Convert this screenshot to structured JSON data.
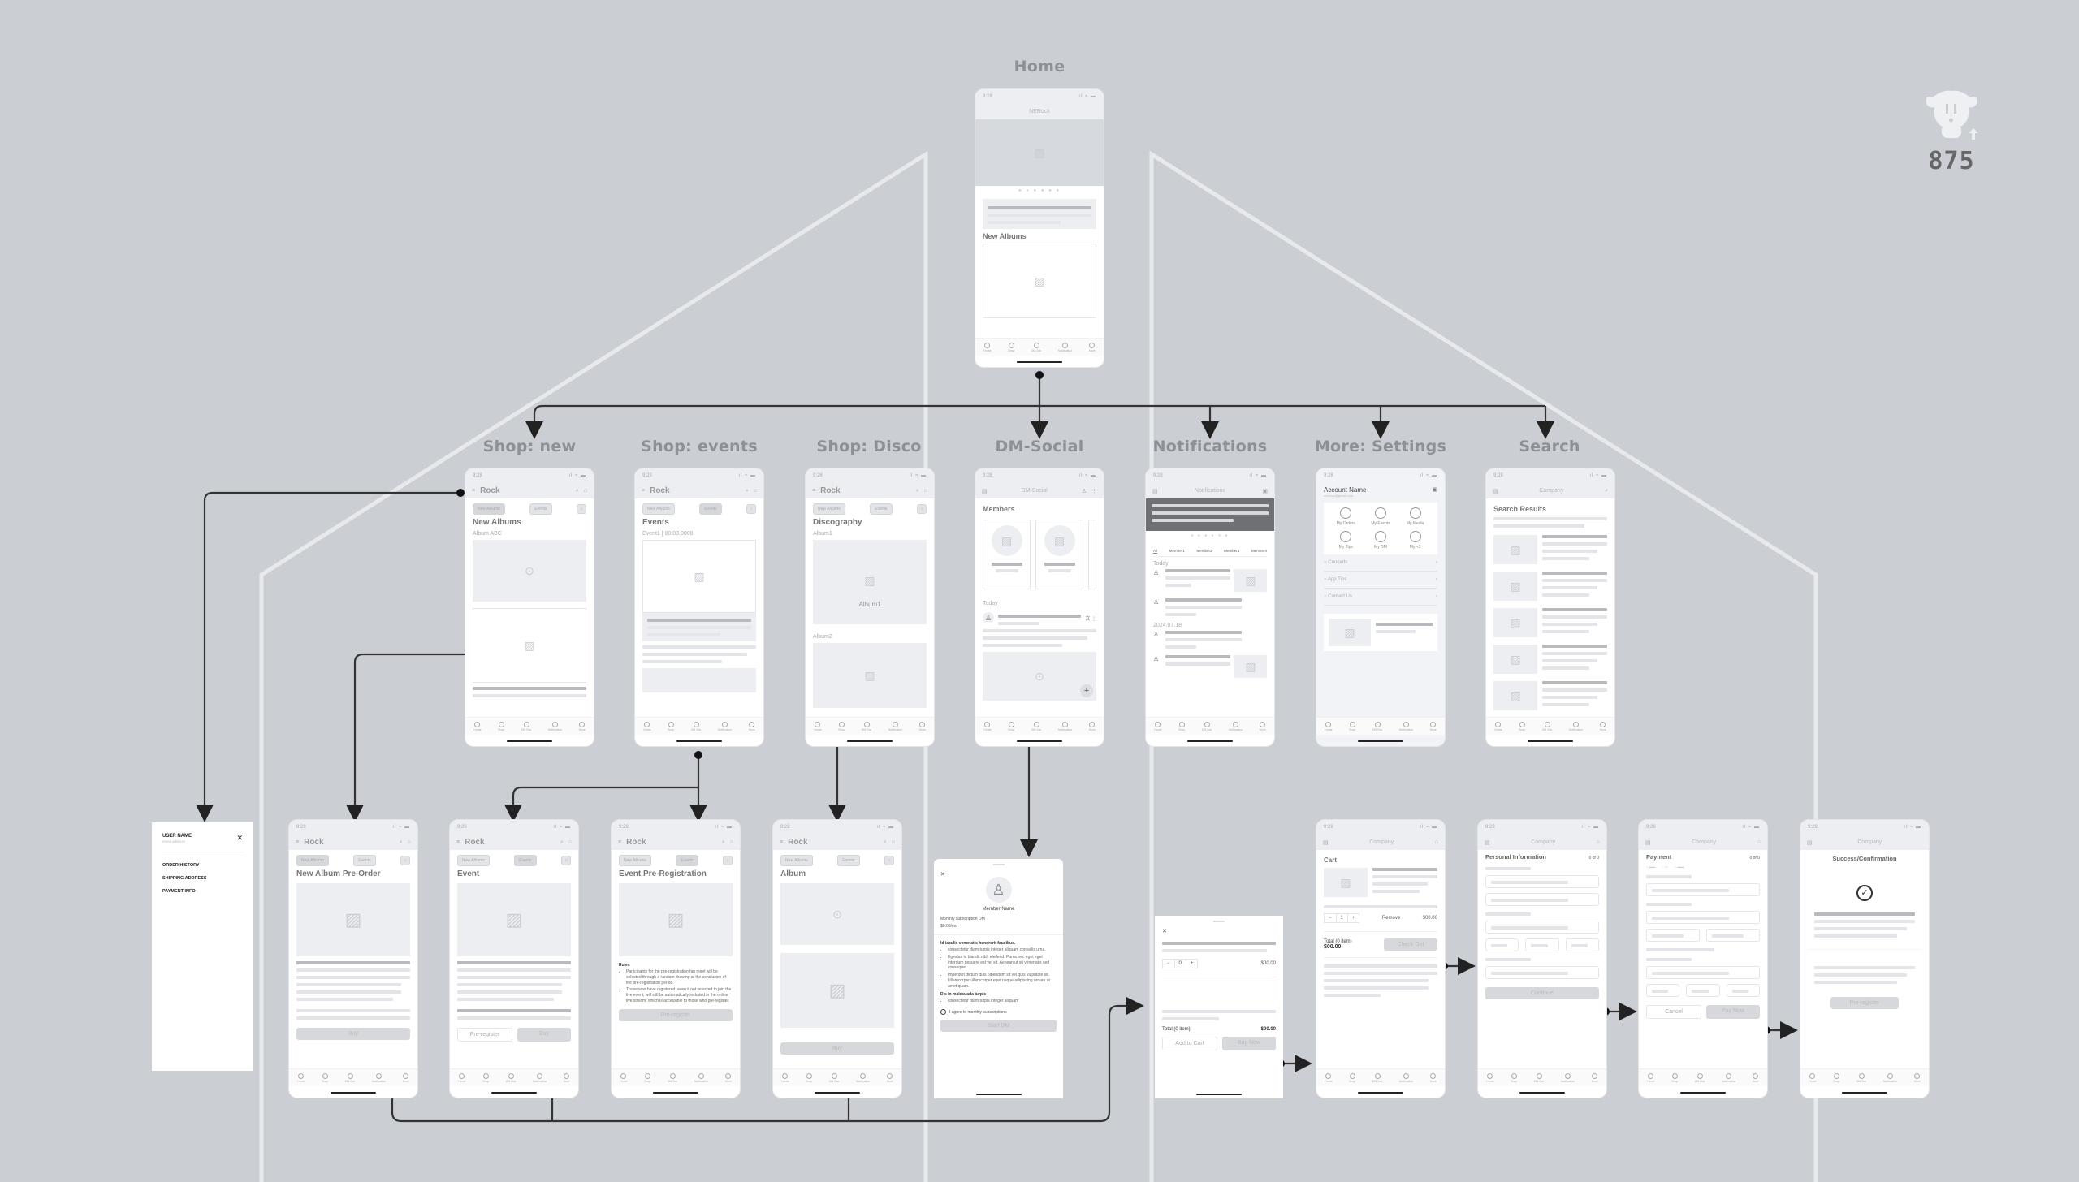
{
  "diagram": {
    "top_label": "Home",
    "brand": "875",
    "section_labels": [
      "Shop: new",
      "Shop: events",
      "Shop: Disco",
      "DM-Social",
      "Notifications",
      "More: Settings",
      "Search"
    ]
  },
  "common": {
    "time": "9:28",
    "signal": "ıl ≈ ▬",
    "tabs": [
      "Home",
      "Shop",
      "DM Soc",
      "Notification",
      "More"
    ],
    "rock_title": "Rock",
    "company_title": "Company",
    "chip_new_albums": "New Albums",
    "chip_events": "Events"
  },
  "home": {
    "app_title": "NERock",
    "section_title": "New Albums",
    "carousel_pages": 6
  },
  "shop_new": {
    "title": "New Albums",
    "subtitle": "Album ABC"
  },
  "shop_events": {
    "title": "Events",
    "subtitle": "Event1 | 00.00.0000"
  },
  "shop_disco": {
    "title": "Discography",
    "album1": "Album1",
    "album1_caption": "Album1",
    "album2": "Album2"
  },
  "dm_social": {
    "app_title": "DM-Social",
    "members_title": "Members",
    "today": "Today"
  },
  "notifications": {
    "app_title": "Notifications",
    "filters": [
      "All",
      "Member1",
      "Member2",
      "Member3",
      "Member4"
    ],
    "today": "Today",
    "date": "2024.07.18"
  },
  "settings": {
    "account_name": "Account Name",
    "email": "xxxxxxx@gmail.com",
    "grid": [
      "My Orders",
      "My Events",
      "My Media",
      "My Tips",
      "My DM",
      "My <3"
    ],
    "menu": [
      "Concerts",
      "App Tips",
      "Contact Us"
    ]
  },
  "search": {
    "title": "Search Results"
  },
  "side_menu": {
    "user_name": "USER NAME",
    "email": "email address",
    "items": [
      "ORDER HISTORY",
      "SHIPPING ADDRESS",
      "PAYMENT INFO"
    ]
  },
  "album_preorder": {
    "title": "New Album Pre-Order",
    "buy": "Buy"
  },
  "event_detail": {
    "title": "Event",
    "preregister": "Pre-register",
    "buy": "Buy"
  },
  "event_prereg": {
    "title": "Event Pre-Registration",
    "rules_title": "Rules",
    "rules": [
      "Participants for the pre-registration fan meet will be selected through a random drawing at the conclusion of the pre-registration period.",
      "Those who have registered, even if not selected to join the live event, will still be automatically included in the online live stream, which is accessible to those who pre-register."
    ],
    "button": "Pre-register"
  },
  "album_detail": {
    "title": "Album",
    "buy": "Buy"
  },
  "dm_subscribe": {
    "member_name": "Member Name",
    "plan": "Monthly subscription DM",
    "price": "$0.00/mo",
    "heading1": "Id iaculis venenatis hendrerit faucibus.",
    "bullets1": [
      "consectetur diam turpis integer aliquam convallis urna.",
      "Egestas id blandit nibh eleifend. Purus nec eget eget interdum posuere est vel sit. Aenean ut sit venenatis sed consequat.",
      "Imperdiet dictum duis bibendum sit vel quis vulputate sit. Ullamcorper ullamcorper eget neque adipiscing ornare ut amet quam."
    ],
    "heading2": "Dis in malesuada turpis",
    "bullets2": [
      "consectetur diam turpis integer aliquam"
    ],
    "agree": "I agree to monthly subscriptions",
    "button": "Start DM"
  },
  "buy_sheet": {
    "qty": "0",
    "price": "$00.00",
    "total_label": "Total (0 item)",
    "total": "$00.00",
    "add_to_cart": "Add to Cart",
    "buy_now": "Buy Now"
  },
  "cart": {
    "title": "Cart",
    "qty": "1",
    "remove": "Remove",
    "price": "$00.00",
    "total_label": "Total (0 item)",
    "total": "$00.00",
    "checkout": "Check Out"
  },
  "personal_info": {
    "title": "Personal Information",
    "step": "0 of 0",
    "button": "Continue"
  },
  "payment": {
    "title": "Payment",
    "step": "0 of 0",
    "cancel": "Cancel",
    "pay": "Pay Now"
  },
  "success": {
    "title": "Success/Confirmation",
    "button": "Pre-register"
  }
}
